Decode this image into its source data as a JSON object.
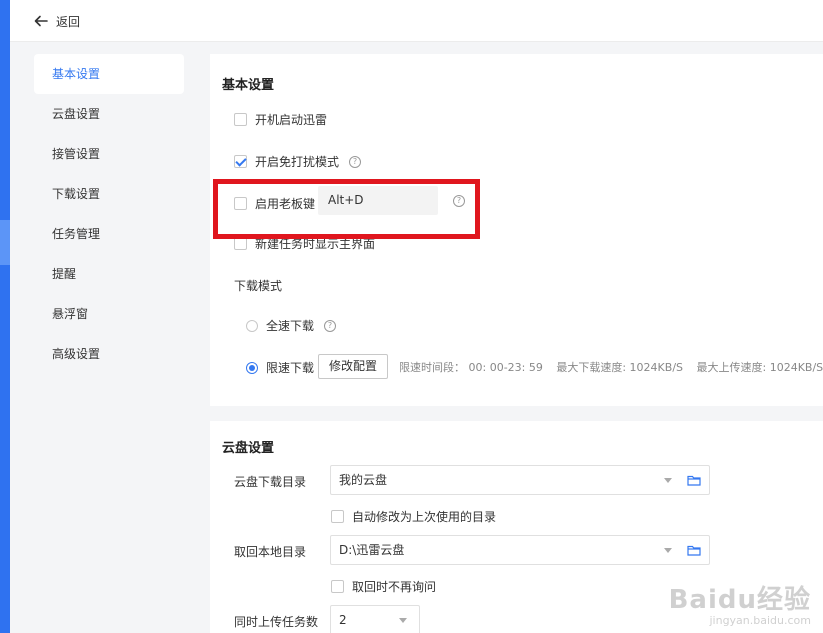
{
  "header": {
    "back_label": "返回"
  },
  "sidebar": {
    "items": [
      {
        "label": "基本设置"
      },
      {
        "label": "云盘设置"
      },
      {
        "label": "接管设置"
      },
      {
        "label": "下载设置"
      },
      {
        "label": "任务管理"
      },
      {
        "label": "提醒"
      },
      {
        "label": "悬浮窗"
      },
      {
        "label": "高级设置"
      }
    ]
  },
  "basic": {
    "title": "基本设置",
    "autostart": {
      "label": "开机启动迅雷",
      "checked": false
    },
    "dnd": {
      "label": "开启免打扰模式",
      "checked": true
    },
    "bosskey": {
      "label": "启用老板键",
      "checked": false,
      "hotkey": "Alt+D"
    },
    "show_main": {
      "label": "新建任务时显示主界面",
      "checked": false
    },
    "download_mode": {
      "label": "下载模式",
      "full_speed": {
        "label": "全速下载",
        "selected": false
      },
      "limited": {
        "label": "限速下载",
        "selected": true
      },
      "modify_button": "修改配置",
      "limit_period": "限速时间段： 00: 00-23: 59",
      "max_download": "最大下载速度: 1024KB/S",
      "max_upload": "最大上传速度: 1024KB/S"
    }
  },
  "cloud": {
    "title": "云盘设置",
    "download_dir": {
      "label": "云盘下载目录",
      "value": "我的云盘"
    },
    "auto_modify": {
      "label": "自动修改为上次使用的目录",
      "checked": false
    },
    "local_dir": {
      "label": "取回本地目录",
      "value": "D:\\迅雷云盘"
    },
    "no_ask": {
      "label": "取回时不再询问",
      "checked": false
    },
    "upload_tasks": {
      "label": "同时上传任务数",
      "value": "2"
    }
  },
  "watermark": {
    "brand": "Baidu经验",
    "url": "jingyan.baidu.com"
  },
  "colors": {
    "accent": "#3478f0",
    "highlight": "#e0161e",
    "stripe": "#2f72f0"
  }
}
